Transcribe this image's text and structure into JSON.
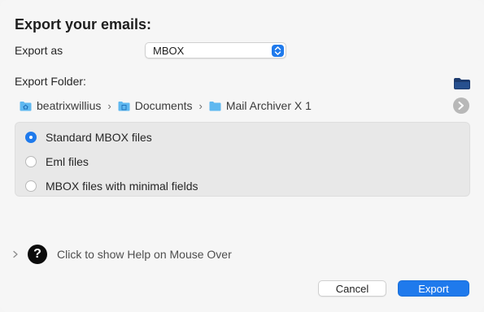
{
  "dialog": {
    "title": "Export your emails:",
    "export_as_label": "Export as",
    "format_popup": {
      "value": "MBOX"
    },
    "export_folder_label": "Export Folder:",
    "path": [
      {
        "label": "beatrixwillius",
        "icon": "home-folder-icon"
      },
      {
        "label": "Documents",
        "icon": "documents-folder-icon"
      },
      {
        "label": "Mail Archiver X 1",
        "icon": "folder-icon"
      }
    ],
    "options": [
      {
        "label": "Standard MBOX files",
        "selected": true
      },
      {
        "label": "Eml files",
        "selected": false
      },
      {
        "label": "MBOX files with minimal fields",
        "selected": false
      }
    ],
    "help": {
      "text": "Click to show Help on Mouse Over",
      "button_glyph": "?"
    },
    "buttons": {
      "cancel": "Cancel",
      "export": "Export"
    }
  },
  "colors": {
    "accent": "#1f7aec",
    "background": "#f6f6f6",
    "group_background": "#e8e8e8",
    "folder_blue": "#5fb8f0",
    "folder_button": "#1d3b6e"
  }
}
